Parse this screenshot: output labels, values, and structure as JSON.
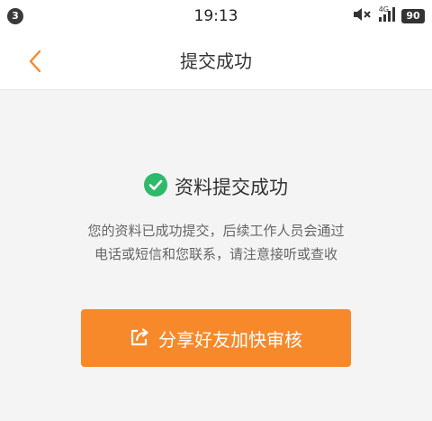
{
  "status_bar": {
    "notification_count": "3",
    "time": "19:13",
    "network": "4G",
    "battery": "90",
    "icons": [
      "mute-icon",
      "signal-icon",
      "battery-icon"
    ]
  },
  "nav": {
    "title": "提交成功",
    "back_icon": "chevron-left-icon"
  },
  "result": {
    "title": "资料提交成功",
    "icon": "check-circle-icon",
    "description_line1": "您的资料已成功提交，后续工作人员会通过",
    "description_line2": "电话或短信和您联系，请注意接听或查收"
  },
  "share_button": {
    "label": "分享好友加快审核",
    "icon": "share-icon"
  },
  "colors": {
    "accent": "#f7892a",
    "success": "#2fb96b",
    "background": "#f4f4f4"
  }
}
